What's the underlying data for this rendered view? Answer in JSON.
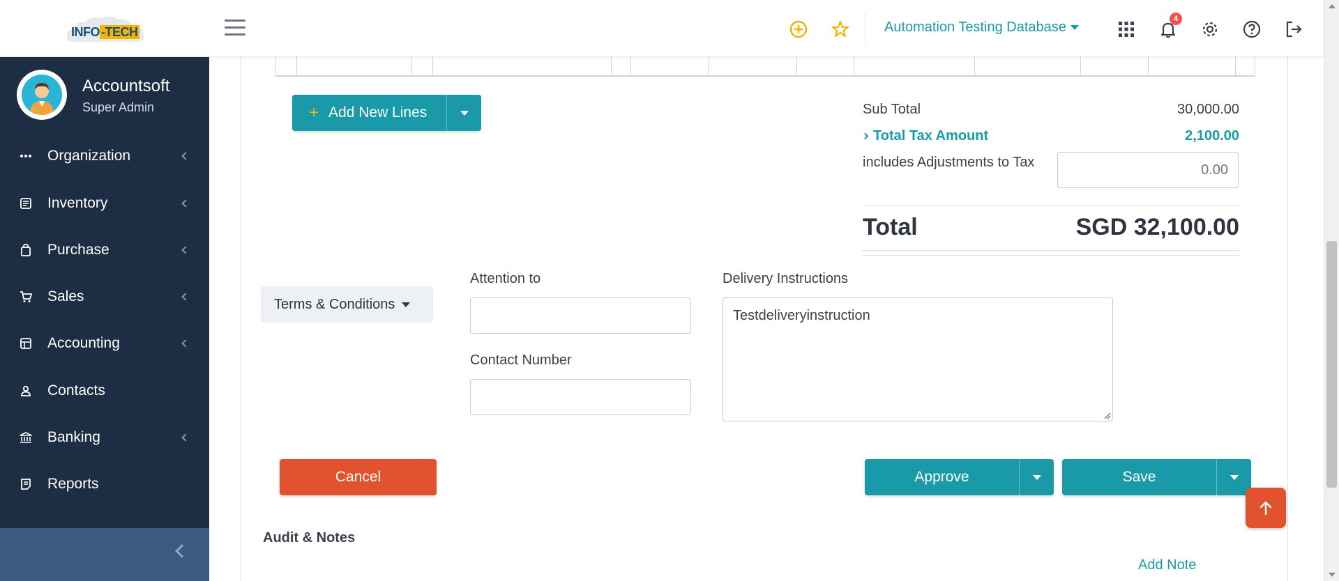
{
  "header": {
    "logo_text_1": "INFO",
    "logo_text_2": "-TECH",
    "database": "Automation Testing Database",
    "notification_count": "4"
  },
  "sidebar": {
    "user_name": "Accountsoft",
    "user_role": "Super Admin",
    "items": [
      {
        "label": "Organization",
        "icon": "dots-icon",
        "has_children": true
      },
      {
        "label": "Inventory",
        "icon": "inventory-icon",
        "has_children": true
      },
      {
        "label": "Purchase",
        "icon": "purchase-bag-icon",
        "has_children": true
      },
      {
        "label": "Sales",
        "icon": "cart-icon",
        "has_children": true
      },
      {
        "label": "Accounting",
        "icon": "ledger-icon",
        "has_children": true
      },
      {
        "label": "Contacts",
        "icon": "person-icon",
        "has_children": false
      },
      {
        "label": "Banking",
        "icon": "bank-icon",
        "has_children": true
      },
      {
        "label": "Reports",
        "icon": "report-icon",
        "has_children": false
      }
    ]
  },
  "actions": {
    "add_lines_label": "Add New Lines",
    "cancel_label": "Cancel",
    "approve_label": "Approve",
    "save_label": "Save"
  },
  "totals": {
    "subtotal_label": "Sub Total",
    "subtotal_value": "30,000.00",
    "tax_label": "Total Tax Amount",
    "tax_value": "2,100.00",
    "adjust_label": "includes Adjustments to Tax",
    "adjust_placeholder": "0.00",
    "total_label": "Total",
    "total_value": "SGD 32,100.00"
  },
  "form": {
    "terms_label": "Terms & Conditions",
    "attention_label": "Attention to",
    "attention_value": "",
    "contact_label": "Contact Number",
    "contact_value": "",
    "delivery_label": "Delivery Instructions",
    "delivery_value": "Testdeliveryinstruction"
  },
  "notes": {
    "section_title": "Audit & Notes",
    "add_note_label": "Add Note"
  },
  "colors": {
    "accent": "#1a9aa8",
    "danger": "#e0532e",
    "sidebar": "#1d2e44"
  }
}
